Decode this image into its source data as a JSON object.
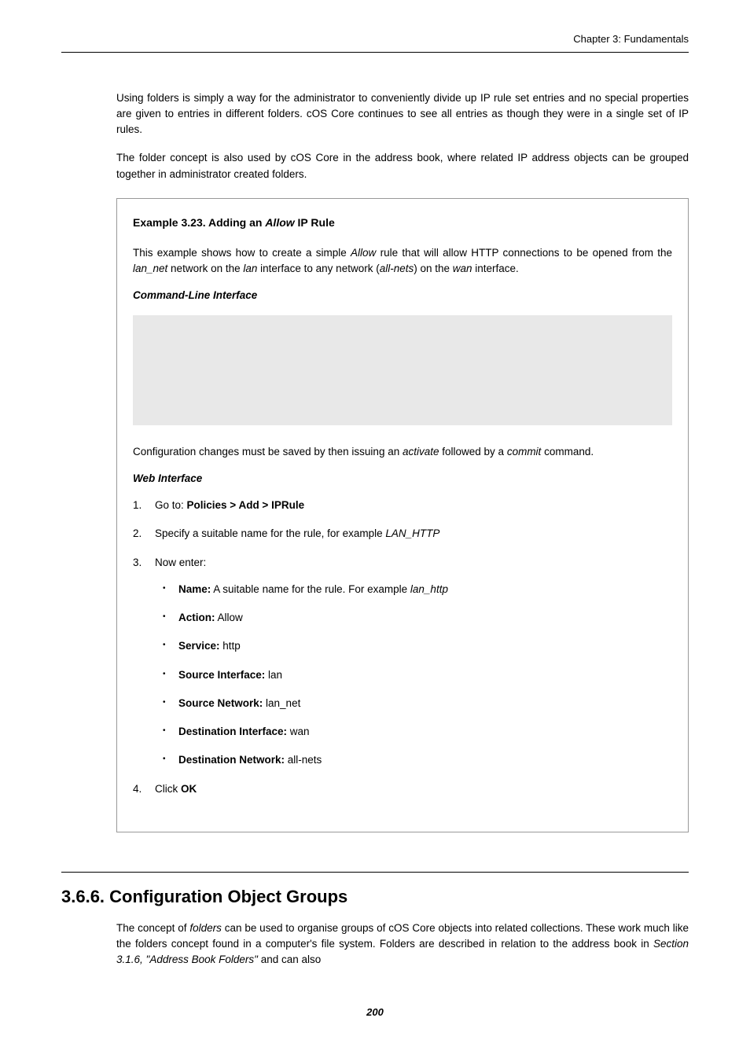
{
  "header": {
    "chapter": "Chapter 3: Fundamentals"
  },
  "intro": {
    "p1": "Using folders is simply a way for the administrator to conveniently divide up IP rule set entries and no special properties are given to entries in different folders. cOS Core continues to see all entries as though they were in a single set of IP rules.",
    "p2": "The folder concept is also used by cOS Core in the address book, where related IP address objects can be grouped together in administrator created folders."
  },
  "example": {
    "title_prefix": "Example 3.23. Adding an ",
    "title_em": "Allow",
    "title_suffix": " IP Rule",
    "desc_1": "This example shows how to create a simple ",
    "desc_em1": "Allow",
    "desc_2": " rule that will allow HTTP connections to be opened from the ",
    "desc_em2": "lan_net",
    "desc_3": " network on the ",
    "desc_em3": "lan",
    "desc_4": " interface to any network (",
    "desc_em4": "all-nets",
    "desc_5": ") on the ",
    "desc_em5": "wan",
    "desc_6": " interface.",
    "cli_heading": "Command-Line Interface",
    "post_cli_1": "Configuration changes must be saved by then issuing an ",
    "post_cli_em1": "activate",
    "post_cli_2": " followed by a ",
    "post_cli_em2": "commit",
    "post_cli_3": " command.",
    "web_heading": "Web Interface",
    "steps": {
      "s1_prefix": "Go to: ",
      "s1_bold": "Policies > Add > IPRule",
      "s2_prefix": "Specify a suitable name for the rule, for example ",
      "s2_em": "LAN_HTTP",
      "s3": "Now enter:",
      "s4_prefix": "Click ",
      "s4_bold": "OK"
    },
    "bullets": {
      "b1_label": "Name:",
      "b1_text": " A suitable name for the rule. For example ",
      "b1_em": "lan_http",
      "b2_label": "Action:",
      "b2_text": " Allow",
      "b3_label": "Service:",
      "b3_text": " http",
      "b4_label": "Source Interface:",
      "b4_text": " lan",
      "b5_label": "Source Network:",
      "b5_text": " lan_net",
      "b6_label": "Destination Interface:",
      "b6_text": " wan",
      "b7_label": "Destination Network:",
      "b7_text": " all-nets"
    }
  },
  "section": {
    "heading": "3.6.6. Configuration Object Groups",
    "p1_a": "The concept of ",
    "p1_em1": "folders",
    "p1_b": " can be used to organise groups of cOS Core objects into related collections. These work much like the folders concept found in a computer's file system. Folders are described in relation to the address book in ",
    "p1_em2": "Section 3.1.6, \"Address Book Folders\"",
    "p1_c": " and can also"
  },
  "page_number": "200"
}
